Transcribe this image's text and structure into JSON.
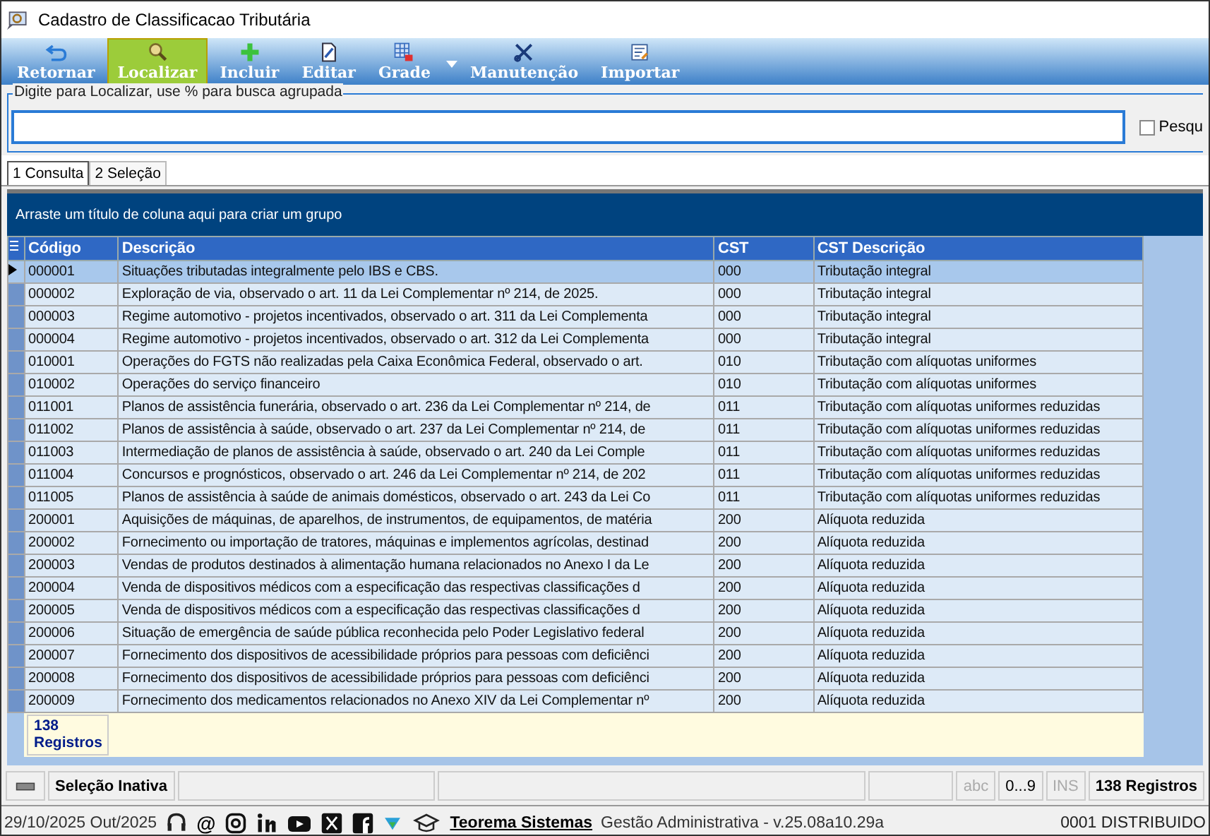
{
  "window": {
    "title": "Cadastro de Classificacao Tributária"
  },
  "toolbar": [
    {
      "label": "Retornar",
      "selected": false,
      "dropdown": false
    },
    {
      "label": "Localizar",
      "selected": true,
      "dropdown": false
    },
    {
      "label": "Incluir",
      "selected": false,
      "dropdown": false
    },
    {
      "label": "Editar",
      "selected": false,
      "dropdown": false
    },
    {
      "label": "Grade",
      "selected": false,
      "dropdown": true
    },
    {
      "label": "Manutenção",
      "selected": false,
      "dropdown": false
    },
    {
      "label": "Importar",
      "selected": false,
      "dropdown": false
    }
  ],
  "search": {
    "legend": "Digite para Localizar, use % para busca agrupada",
    "option": {
      "label": "Pesqu",
      "checked": false
    }
  },
  "tabs": [
    {
      "label": "1 Consulta",
      "selected": true
    },
    {
      "label": "2 Seleção",
      "selected": false
    }
  ],
  "group_panel": {
    "hint": "Arraste um título de coluna aqui para criar um grupo"
  },
  "table": {
    "columns": [
      "Código",
      "Descrição",
      "CST",
      "CST Descrição"
    ],
    "rows": [
      {
        "cells": [
          "000001",
          "Situações tributadas integralmente pelo IBS e CBS.",
          "000",
          "Tributação integral"
        ],
        "selected": true
      },
      {
        "cells": [
          "000002",
          "Exploração de via, observado o art. 11 da Lei Complementar nº 214, de 2025.",
          "000",
          "Tributação integral"
        ],
        "selected": false
      },
      {
        "cells": [
          "000003",
          "Regime automotivo - projetos incentivados, observado o art. 311 da Lei Complementa",
          "000",
          "Tributação integral"
        ],
        "selected": false
      },
      {
        "cells": [
          "000004",
          "Regime automotivo - projetos incentivados, observado o art. 312 da Lei Complementa",
          "000",
          "Tributação integral"
        ],
        "selected": false
      },
      {
        "cells": [
          "010001",
          "Operações do FGTS não realizadas pela Caixa Econômica Federal, observado o art.",
          "010",
          "Tributação com alíquotas uniformes"
        ],
        "selected": false
      },
      {
        "cells": [
          "010002",
          "Operações do serviço financeiro",
          "010",
          "Tributação com alíquotas uniformes"
        ],
        "selected": false
      },
      {
        "cells": [
          "011001",
          "Planos de assistência funerária, observado o art. 236 da Lei Complementar nº 214, de",
          "011",
          "Tributação com alíquotas uniformes reduzidas"
        ],
        "selected": false
      },
      {
        "cells": [
          "011002",
          "Planos de assistência à saúde, observado o art. 237 da Lei Complementar nº 214, de",
          "011",
          "Tributação com alíquotas uniformes reduzidas"
        ],
        "selected": false
      },
      {
        "cells": [
          "011003",
          "Intermediação de planos de assistência à saúde, observado o art. 240 da Lei Comple",
          "011",
          "Tributação com alíquotas uniformes reduzidas"
        ],
        "selected": false
      },
      {
        "cells": [
          "011004",
          "Concursos e prognósticos, observado o art. 246 da Lei Complementar nº 214, de 202",
          "011",
          "Tributação com alíquotas uniformes reduzidas"
        ],
        "selected": false
      },
      {
        "cells": [
          "011005",
          "Planos de assistência à saúde de animais domésticos, observado o art. 243 da Lei Co",
          "011",
          "Tributação com alíquotas uniformes reduzidas"
        ],
        "selected": false
      },
      {
        "cells": [
          "200001",
          "Aquisições de máquinas, de aparelhos, de instrumentos, de equipamentos, de matéria",
          "200",
          "Alíquota reduzida"
        ],
        "selected": false
      },
      {
        "cells": [
          "200002",
          "Fornecimento ou importação de tratores, máquinas e implementos agrícolas, destinad",
          "200",
          "Alíquota reduzida"
        ],
        "selected": false
      },
      {
        "cells": [
          "200003",
          "Vendas de produtos destinados à alimentação humana relacionados no Anexo I da Le",
          "200",
          "Alíquota reduzida"
        ],
        "selected": false
      },
      {
        "cells": [
          "200004",
          "Venda de dispositivos médicos com a especificação das respectivas classificações d",
          "200",
          "Alíquota reduzida"
        ],
        "selected": false
      },
      {
        "cells": [
          "200005",
          "Venda de dispositivos médicos com a especificação das respectivas classificações d",
          "200",
          "Alíquota reduzida"
        ],
        "selected": false
      },
      {
        "cells": [
          "200006",
          "Situação de emergência de saúde pública reconhecida pelo Poder Legislativo federal",
          "200",
          "Alíquota reduzida"
        ],
        "selected": false
      },
      {
        "cells": [
          "200007",
          "Fornecimento dos dispositivos de acessibilidade próprios para pessoas com deficiênci",
          "200",
          "Alíquota reduzida"
        ],
        "selected": false
      },
      {
        "cells": [
          "200008",
          "Fornecimento dos dispositivos de acessibilidade próprios para pessoas com deficiênci",
          "200",
          "Alíquota reduzida"
        ],
        "selected": false
      },
      {
        "cells": [
          "200009",
          "Fornecimento dos medicamentos relacionados no Anexo XIV da Lei Complementar nº",
          "200",
          "Alíquota reduzida"
        ],
        "selected": false
      }
    ],
    "footer": {
      "count": "138",
      "unit": "Registros"
    }
  },
  "status_bar": {
    "selection": "Seleção Inativa",
    "panels": [
      {
        "text": "abc",
        "disabled": true
      },
      {
        "text": "0...9",
        "disabled": false
      },
      {
        "text": "INS",
        "disabled": true
      }
    ],
    "records": "138 Registros"
  },
  "bottom_bar": {
    "date": "29/10/2025 Out/2025",
    "at_sign": "@",
    "company_link": "Teorema Sistemas",
    "version": "Gestão Administrativa - v.25.08a10.29a",
    "branch": "0001 DISTRIBUIDO"
  }
}
